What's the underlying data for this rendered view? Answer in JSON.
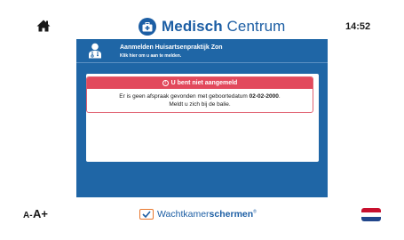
{
  "header": {
    "brand_bold": "Medisch",
    "brand_light": "Centrum",
    "time": "14:52"
  },
  "checkin": {
    "title": "Aanmelden Huisartsenpraktijk Zon",
    "subtitle": "Klik hier om u aan te melden."
  },
  "alert": {
    "title": "U bent niet aangemeld",
    "message_prefix": "Er is geen afspraak gevonden met geboortedatum ",
    "birthdate": "02-02-2000",
    "message_suffix": ".",
    "message_line2": "Meldt u zich bij de balie."
  },
  "footer": {
    "font_small_label": "A-",
    "font_large_label": "A+",
    "logo_part1": "Wachtkamer",
    "logo_part2": "schermen",
    "logo_mark": "®",
    "language": "Nederlands"
  },
  "colors": {
    "brand_blue": "#1c5ea4",
    "panel_blue": "#1f66a6",
    "alert_red": "#e2495c",
    "logo_orange": "#e8772e"
  }
}
